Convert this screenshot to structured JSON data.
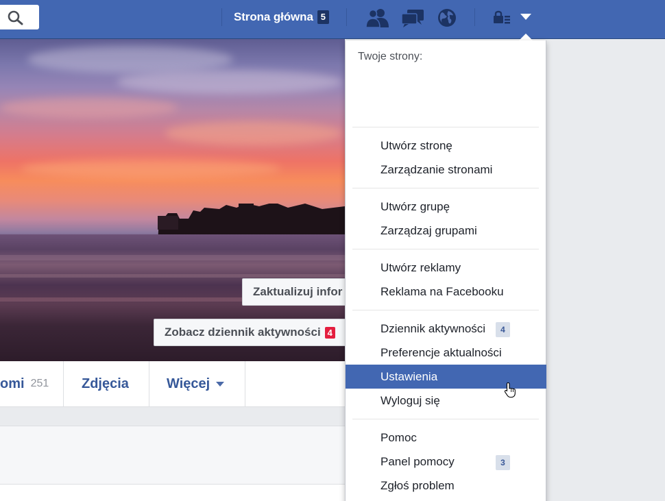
{
  "topbar": {
    "home_label": "Strona główna",
    "home_count": "5",
    "icons": [
      "search-icon",
      "friends-icon",
      "messages-icon",
      "notifications-globe-icon",
      "privacy-lock-icon",
      "account-menu-caret-icon"
    ]
  },
  "cover": {
    "update_button": "Zaktualizuj infor",
    "activity_log_button": "Zobacz dziennik aktywności",
    "activity_log_badge": "4"
  },
  "profile_nav": {
    "friends_label": "omi",
    "friends_count": "251",
    "photos_label": "Zdjęcia",
    "more_label": "Więcej"
  },
  "dropdown": {
    "header": "Twoje strony:",
    "items": [
      {
        "label": "Utwórz stronę"
      },
      {
        "label": "Zarządzanie stronami"
      },
      {
        "label": "Utwórz grupę"
      },
      {
        "label": "Zarządzaj grupami"
      },
      {
        "label": "Utwórz reklamy"
      },
      {
        "label": "Reklama na Facebooku"
      },
      {
        "label": "Dziennik aktywności",
        "badge": "4"
      },
      {
        "label": "Preferencje aktualności"
      },
      {
        "label": "Ustawienia",
        "active": true
      },
      {
        "label": "Wyloguj się"
      },
      {
        "label": "Pomoc"
      },
      {
        "label": "Panel pomocy",
        "badge": "3"
      },
      {
        "label": "Zgłoś problem"
      }
    ]
  },
  "colors": {
    "brand_blue": "#4267b2",
    "link_blue": "#365899",
    "badge_red": "#e41e3f"
  }
}
